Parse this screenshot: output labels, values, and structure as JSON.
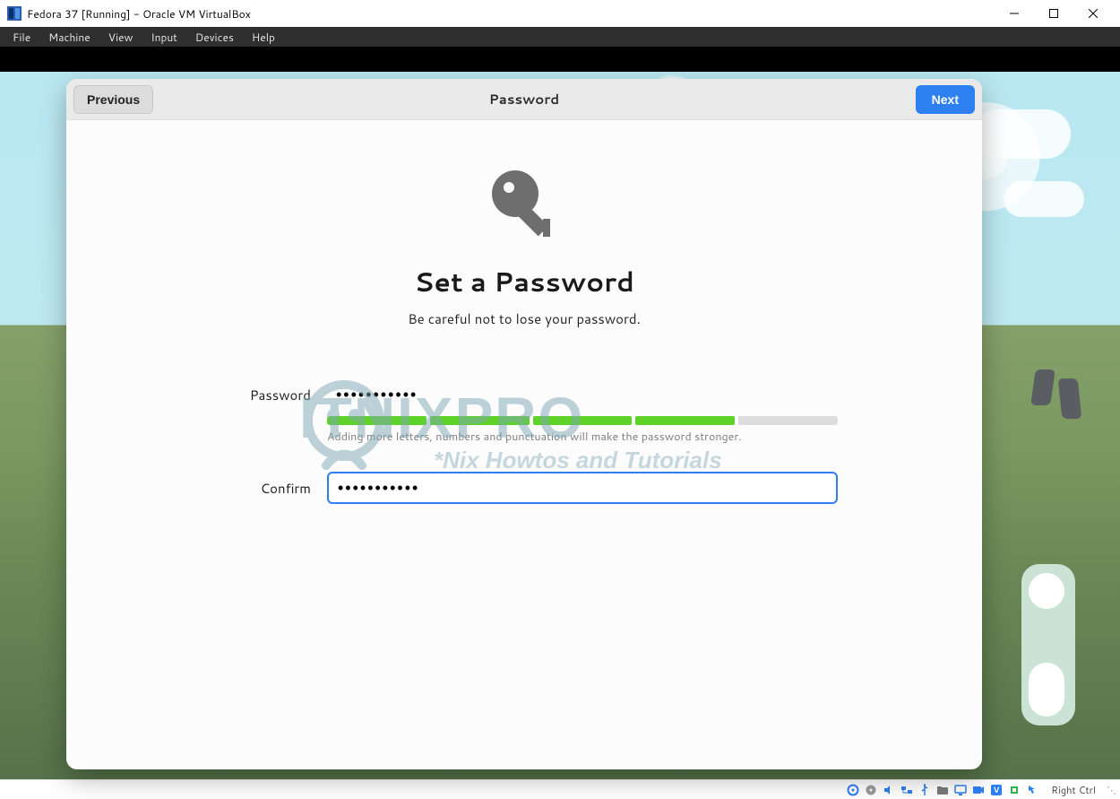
{
  "window": {
    "title": "Fedora 37 [Running] - Oracle VM VirtualBox"
  },
  "menubar": {
    "file": "File",
    "machine": "Machine",
    "view": "View",
    "input": "Input",
    "devices": "Devices",
    "help": "Help"
  },
  "dialog": {
    "header_title": "Password",
    "previous_label": "Previous",
    "next_label": "Next",
    "heading": "Set a Password",
    "subheading": "Be careful not to lose your password.",
    "password_label": "Password",
    "confirm_label": "Confirm",
    "password_value": "•••••••••••",
    "confirm_value": "•••••••••••",
    "strength_hint": "Adding more letters, numbers and punctuation will make the password stronger.",
    "strength_segments_on": 4,
    "strength_segments_total": 5
  },
  "watermark": {
    "brand": "ITNIXPRO",
    "tagline": "*Nix Howtos and Tutorials"
  },
  "statusbar": {
    "hostkey": "Right Ctrl"
  }
}
